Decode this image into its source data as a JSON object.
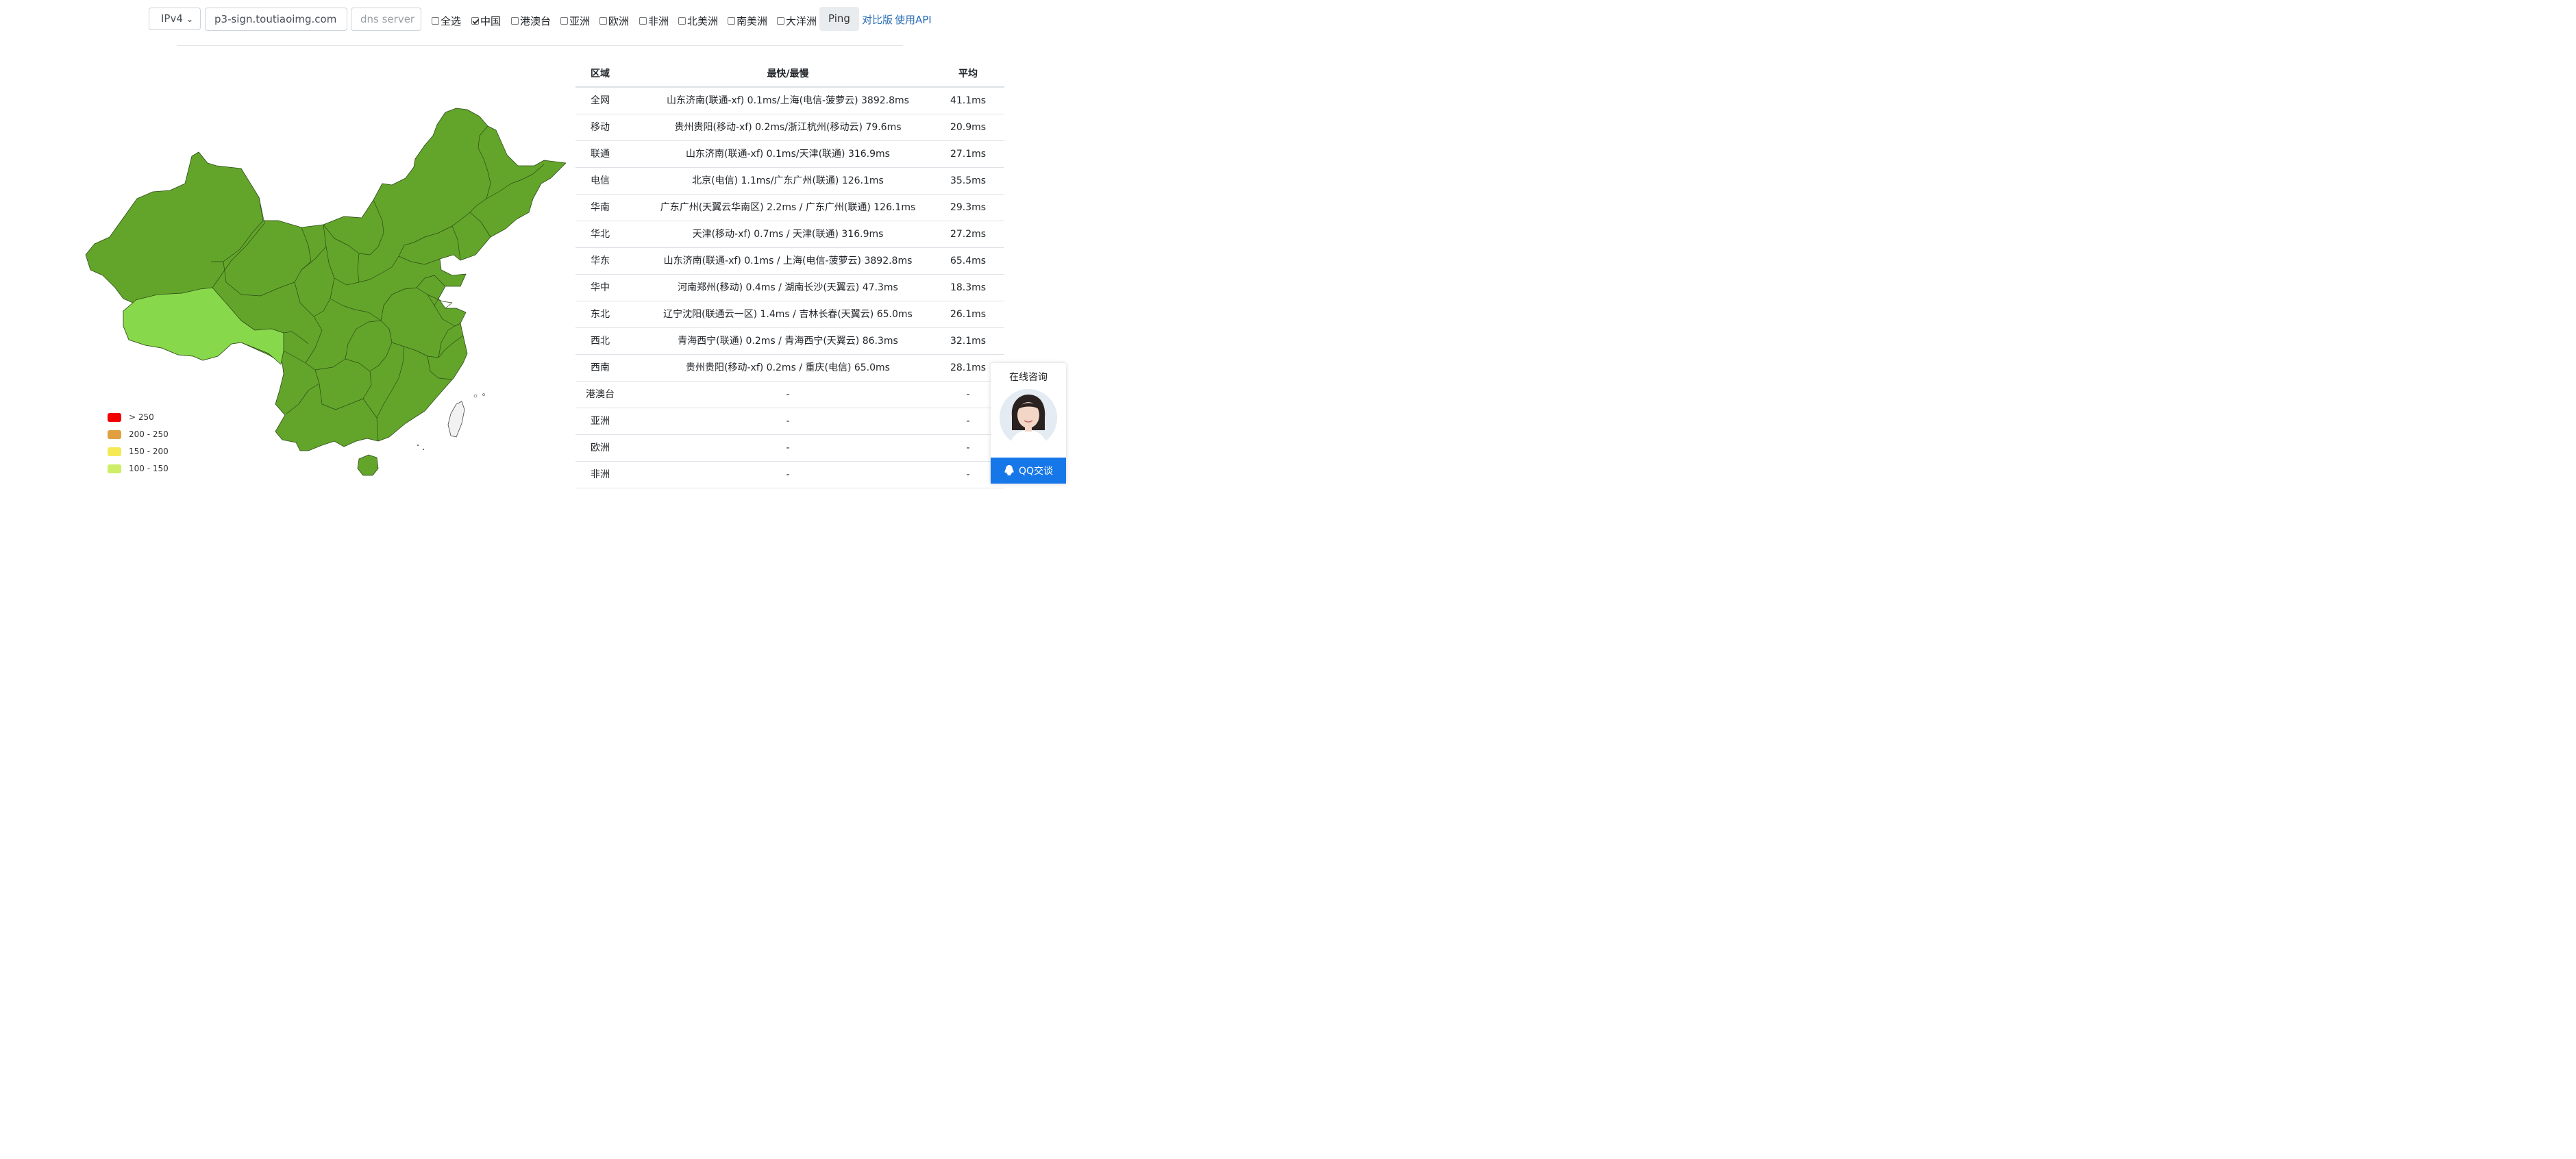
{
  "toolbar": {
    "ip_version": "IPv4",
    "domain_value": "p3-sign.toutiaoimg.com",
    "dns_placeholder": "dns server",
    "checkboxes": [
      {
        "label": "全选",
        "checked": false
      },
      {
        "label": "中国",
        "checked": true
      },
      {
        "label": "港澳台",
        "checked": false
      },
      {
        "label": "亚洲",
        "checked": false
      },
      {
        "label": "欧洲",
        "checked": false
      },
      {
        "label": "非洲",
        "checked": false
      },
      {
        "label": "北美洲",
        "checked": false
      },
      {
        "label": "南美洲",
        "checked": false
      },
      {
        "label": "大洋洲",
        "checked": false
      }
    ],
    "ping_label": "Ping",
    "compare_link": "对比版",
    "api_link": "使用API"
  },
  "map": {
    "fill_colors": {
      "lt_100": "#62a52a",
      "tibet": "#88d84b"
    }
  },
  "legend": [
    {
      "label": "> 250",
      "color": "#f20000"
    },
    {
      "label": "200 - 250",
      "color": "#e0a040"
    },
    {
      "label": "150 - 200",
      "color": "#f4ea55"
    },
    {
      "label": "100 - 150",
      "color": "#cdee66"
    }
  ],
  "table": {
    "headers": {
      "region": "区域",
      "fast_slow": "最快/最慢",
      "avg": "平均"
    },
    "rows": [
      {
        "region": "全网",
        "fast_slow": "山东济南(联通-xf) 0.1ms/上海(电信-菠萝云) 3892.8ms",
        "avg": "41.1ms"
      },
      {
        "region": "移动",
        "fast_slow": "贵州贵阳(移动-xf) 0.2ms/浙江杭州(移动云) 79.6ms",
        "avg": "20.9ms"
      },
      {
        "region": "联通",
        "fast_slow": "山东济南(联通-xf) 0.1ms/天津(联通) 316.9ms",
        "avg": "27.1ms"
      },
      {
        "region": "电信",
        "fast_slow": "北京(电信) 1.1ms/广东广州(联通) 126.1ms",
        "avg": "35.5ms"
      },
      {
        "region": "华南",
        "fast_slow": "广东广州(天翼云华南区) 2.2ms / 广东广州(联通) 126.1ms",
        "avg": "29.3ms"
      },
      {
        "region": "华北",
        "fast_slow": "天津(移动-xf) 0.7ms / 天津(联通) 316.9ms",
        "avg": "27.2ms"
      },
      {
        "region": "华东",
        "fast_slow": "山东济南(联通-xf) 0.1ms / 上海(电信-菠萝云) 3892.8ms",
        "avg": "65.4ms"
      },
      {
        "region": "华中",
        "fast_slow": "河南郑州(移动) 0.4ms / 湖南长沙(天翼云) 47.3ms",
        "avg": "18.3ms"
      },
      {
        "region": "东北",
        "fast_slow": "辽宁沈阳(联通云一区) 1.4ms / 吉林长春(天翼云) 65.0ms",
        "avg": "26.1ms"
      },
      {
        "region": "西北",
        "fast_slow": "青海西宁(联通) 0.2ms / 青海西宁(天翼云) 86.3ms",
        "avg": "32.1ms"
      },
      {
        "region": "西南",
        "fast_slow": "贵州贵阳(移动-xf) 0.2ms / 重庆(电信) 65.0ms",
        "avg": "28.1ms"
      },
      {
        "region": "港澳台",
        "fast_slow": "-",
        "avg": "-"
      },
      {
        "region": "亚洲",
        "fast_slow": "-",
        "avg": "-"
      },
      {
        "region": "欧洲",
        "fast_slow": "-",
        "avg": "-"
      },
      {
        "region": "非洲",
        "fast_slow": "-",
        "avg": "-"
      }
    ]
  },
  "chat": {
    "title": "在线咨询",
    "qq_label": "QQ交谈",
    "button_color": "#1677e8"
  }
}
